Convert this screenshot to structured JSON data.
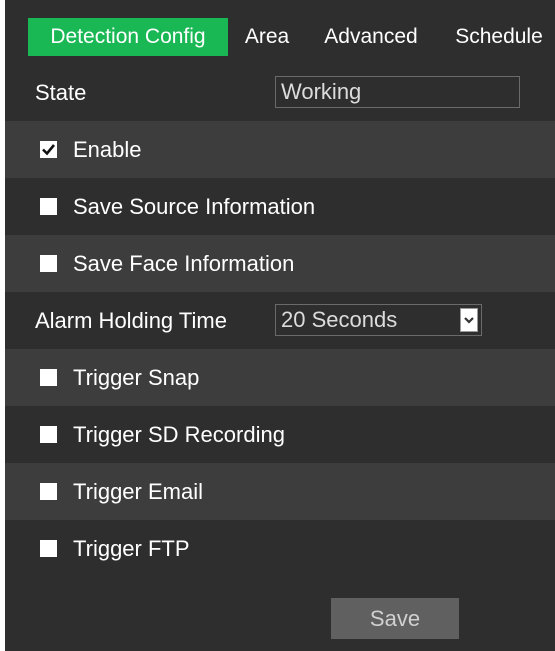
{
  "tabs": {
    "detection_config": "Detection Config",
    "area": "Area",
    "advanced": "Advanced",
    "schedule": "Schedule"
  },
  "state": {
    "label": "State",
    "value": "Working"
  },
  "options": {
    "enable": {
      "label": "Enable",
      "checked": true
    },
    "save_source": {
      "label": "Save Source Information",
      "checked": false
    },
    "save_face": {
      "label": "Save Face Information",
      "checked": false
    }
  },
  "alarm_holding_time": {
    "label": "Alarm Holding Time",
    "selected": "20 Seconds"
  },
  "triggers": {
    "snap": {
      "label": "Trigger Snap",
      "checked": false
    },
    "sd_recording": {
      "label": "Trigger SD Recording",
      "checked": false
    },
    "email": {
      "label": "Trigger Email",
      "checked": false
    },
    "ftp": {
      "label": "Trigger FTP",
      "checked": false
    }
  },
  "save_button": "Save",
  "colors": {
    "accent": "#19b854",
    "panel_bg": "#2e2e2e",
    "row_alt_bg": "#3d3d3d",
    "button_bg": "#606060"
  }
}
